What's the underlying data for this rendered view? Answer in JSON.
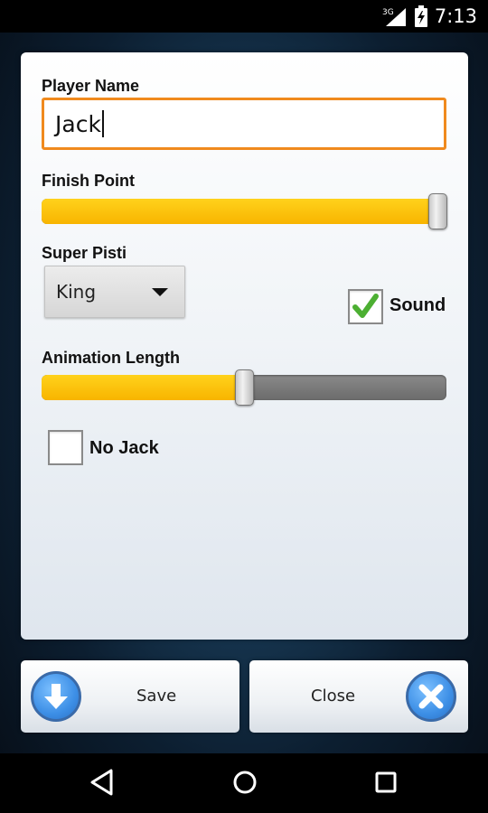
{
  "status_bar": {
    "time": "7:13",
    "network": "3G"
  },
  "form": {
    "player_name_label": "Player Name",
    "player_name_value": "Jack",
    "finish_point_label": "Finish Point",
    "finish_point_level": 1.0,
    "super_pisti_label": "Super Pisti",
    "super_pisti_selected": "King",
    "sound_label": "Sound",
    "sound_checked": true,
    "animation_length_label": "Animation Length",
    "animation_length_level": 0.5,
    "no_jack_label": "No Jack",
    "no_jack_checked": false
  },
  "buttons": {
    "save_label": "Save",
    "close_label": "Close"
  },
  "icons": {
    "save": "download-arrow-icon",
    "close": "close-x-icon",
    "sound_check": "checkmark-icon",
    "nav": [
      "back-icon",
      "home-icon",
      "recents-icon"
    ]
  },
  "colors": {
    "input_focus_border": "#f08a1e",
    "slider_fill": "#f8b400",
    "checkmark": "#4caf32",
    "button_icon": "#3d8fe6"
  }
}
